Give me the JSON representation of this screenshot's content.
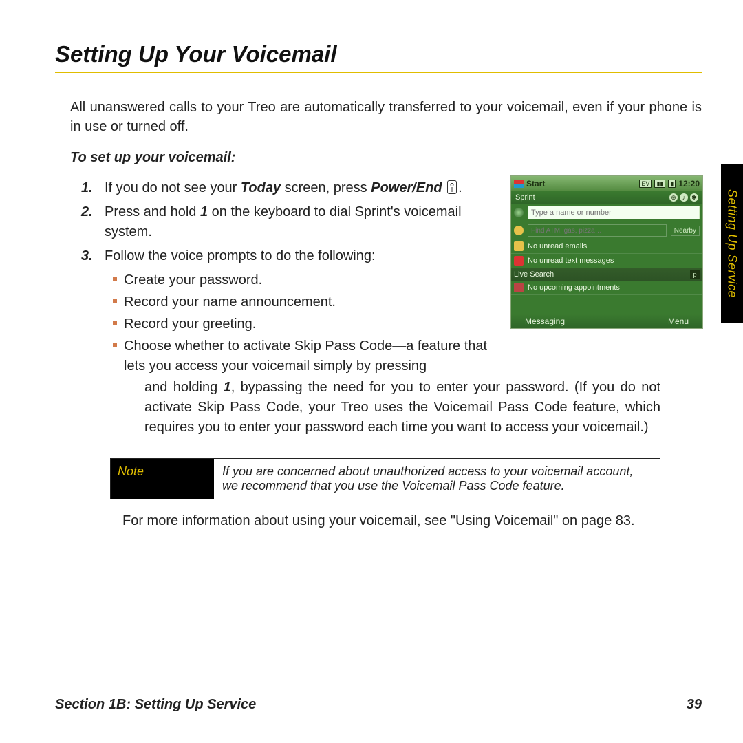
{
  "heading": "Setting Up Your Voicemail",
  "intro": "All unanswered calls to your Treo are automatically transferred to your voicemail, even if your phone is in use or turned off.",
  "subhead": "To set up your voicemail:",
  "steps": {
    "s1_a": "If you do not see your ",
    "s1_today": "Today",
    "s1_b": " screen, press ",
    "s1_power": "Power/End",
    "s1_c": " .",
    "s2_a": "Press and hold ",
    "s2_one": "1",
    "s2_b": " on the keyboard to dial Sprint's voicemail system.",
    "s3": "Follow the voice prompts to do the following:"
  },
  "sub": {
    "b1": "Create your password.",
    "b2": "Record your name announcement.",
    "b3": "Record your greeting.",
    "b4": "Choose whether to activate Skip Pass Code—a feature that lets you access your voicemail simply by pressing"
  },
  "cont_a": "and holding ",
  "cont_one": "1",
  "cont_b": ", bypassing the need for you to enter your password. (If you do not activate Skip Pass Code, your Treo uses the Voicemail Pass Code feature, which requires you to enter your password each time you want to access your voicemail.)",
  "note_label": "Note",
  "note_body": "If you are concerned about unauthorized access to your voicemail account, we recommend that you use the Voicemail Pass Code feature.",
  "more_info": "For more information about using your voicemail, see \"Using Voicemail\" on page 83.",
  "footer_left": "Section 1B: Setting Up Service",
  "footer_right": "39",
  "side_tab": "Setting Up Service",
  "shot": {
    "start": "Start",
    "ev": "EV",
    "time": "12:20",
    "carrier": "Sprint",
    "dial_placeholder": "Type a name or number",
    "find_placeholder": "Find ATM, gas, pizza…",
    "nearby": "Nearby",
    "emails": "No unread emails",
    "texts": "No unread text messages",
    "live": "Live Search",
    "appts": "No upcoming appointments",
    "soft_left": "Messaging",
    "soft_right": "Menu"
  }
}
